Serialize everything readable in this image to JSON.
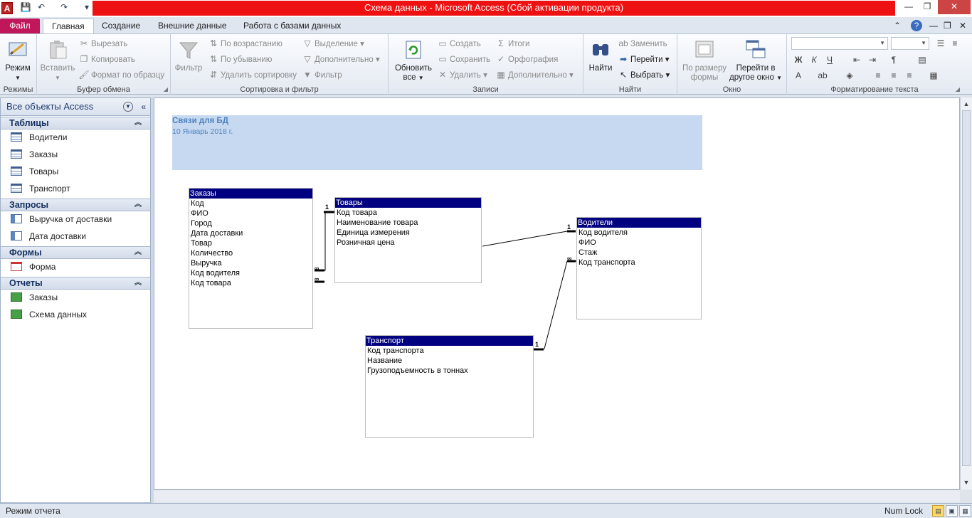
{
  "window": {
    "title": "Схема данных  -  Microsoft Access (Сбой активации продукта)",
    "app_icon_letter": "A",
    "controls": {
      "minimize": "—",
      "restore": "❐",
      "close": "✕"
    }
  },
  "quick_access": {
    "save": "💾",
    "undo": "↶",
    "redo": "↷",
    "customize": "▾"
  },
  "ribbon_tabs": [
    "Файл",
    "Главная",
    "Создание",
    "Внешние данные",
    "Работа с базами данных"
  ],
  "ribbon_right": {
    "up": "⌃",
    "help": "?",
    "min": "—",
    "restore": "❐",
    "close": "✕"
  },
  "ribbon": {
    "modes": {
      "label": "Режимы",
      "view": "Режим"
    },
    "clipboard": {
      "label": "Буфер обмена",
      "paste": "Вставить",
      "cut": "Вырезать",
      "copy": "Копировать",
      "format_painter": "Формат по образцу"
    },
    "sort_filter": {
      "label": "Сортировка и фильтр",
      "filter": "Фильтр",
      "ascending": "По возрастанию",
      "descending": "По убыванию",
      "remove_sort": "Удалить сортировку",
      "selection": "Выделение",
      "advanced": "Дополнительно",
      "toggle_filter": "Фильтр"
    },
    "records": {
      "label": "Записи",
      "refresh_line1": "Обновить",
      "refresh_line2": "все",
      "new": "Создать",
      "save": "Сохранить",
      "delete": "Удалить",
      "totals": "Итоги",
      "spelling": "Орфография",
      "more": "Дополнительно"
    },
    "find": {
      "label": "Найти",
      "find": "Найти",
      "replace": "Заменить",
      "goto": "Перейти",
      "select": "Выбрать"
    },
    "window": {
      "label": "Окно",
      "fit_line1": "По размеру",
      "fit_line2": "формы",
      "switch_line1": "Перейти в",
      "switch_line2": "другое окно"
    },
    "text_format": {
      "label": "Форматирование текста",
      "bold": "Ж",
      "italic": "К",
      "underline": "Ч",
      "font_color": "A"
    }
  },
  "nav_pane": {
    "header": "Все объекты Access",
    "sections": [
      {
        "title": "Таблицы",
        "items": [
          "Водители",
          "Заказы",
          "Товары",
          "Транспорт"
        ]
      },
      {
        "title": "Запросы",
        "items": [
          "Выручка от доставки",
          "Дата доставки"
        ]
      },
      {
        "title": "Формы",
        "items": [
          "Форма"
        ]
      },
      {
        "title": "Отчеты",
        "items": [
          "Заказы",
          "Схема данных"
        ]
      }
    ]
  },
  "report": {
    "title": "Связи для БД",
    "date": "10 Январь 2018 г.",
    "tables": [
      {
        "name": "Заказы",
        "fields": [
          "Код",
          "ФИО",
          "Город",
          "Дата доставки",
          "Товар",
          "Количество",
          "Выручка",
          "Код водителя",
          "Код товара"
        ]
      },
      {
        "name": "Товары",
        "fields": [
          "Код товара",
          "Наименование товара",
          "Единица измерения",
          "Розничная цена"
        ]
      },
      {
        "name": "Водители",
        "fields": [
          "Код водителя",
          "ФИО",
          "Стаж",
          "Код транспорта"
        ]
      },
      {
        "name": "Транспорт",
        "fields": [
          "Код транспорта",
          "Название",
          "Грузоподъемность в тоннах"
        ]
      }
    ],
    "relation_labels": {
      "one": "1",
      "many": "∞"
    }
  },
  "status": {
    "message": "Режим отчета",
    "numlock": "Num Lock"
  }
}
